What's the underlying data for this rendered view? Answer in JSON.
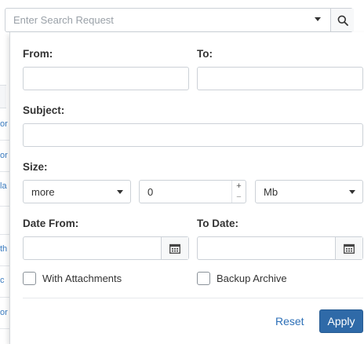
{
  "background": {
    "fragments": [
      "or",
      "or",
      "la",
      "th",
      "c",
      "or"
    ]
  },
  "search": {
    "placeholder": "Enter Search Request",
    "value": ""
  },
  "form": {
    "from_label": "From:",
    "to_label": "To:",
    "subject_label": "Subject:",
    "size_label": "Size:",
    "size_comparator": "more",
    "size_value": "0",
    "size_unit": "Mb",
    "date_from_label": "Date From:",
    "to_date_label": "To Date:",
    "with_attachments_label": "With Attachments",
    "with_attachments_checked": false,
    "backup_archive_label": "Backup Archive",
    "backup_archive_checked": false,
    "spin_up_symbol": "+",
    "spin_down_symbol": "−"
  },
  "actions": {
    "reset_label": "Reset",
    "apply_label": "Apply"
  },
  "colors": {
    "accent": "#2f6aa8",
    "link": "#2c6fb7"
  },
  "icons": {
    "search": "search-icon",
    "calendar": "calendar-icon",
    "dropdown": "chevron-down-icon"
  }
}
